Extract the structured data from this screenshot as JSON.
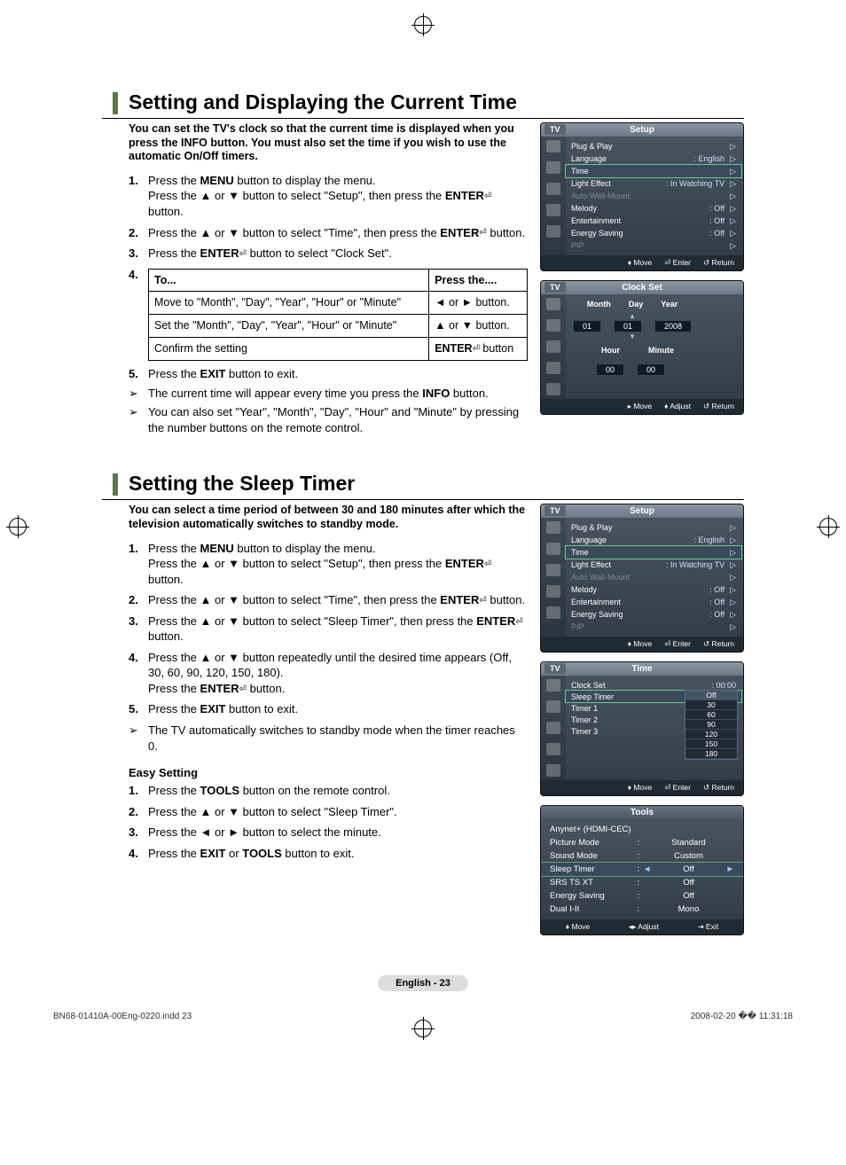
{
  "section1": {
    "title": "Setting and Displaying the Current Time",
    "intro": "You can set the TV's clock so that the current time is displayed when you press the INFO button. You must also set the time if you wish to use the automatic On/Off timers.",
    "step1a": "Press the ",
    "step1b": " button to display the menu.",
    "step1c": "Press the ▲ or ▼ button to select \"Setup\", then press the ",
    "step1d": " button.",
    "step2a": "Press the ▲ or ▼ button to select \"Time\", then press the ",
    "step2b": " button.",
    "step3a": "Press the ",
    "step3b": " button to select \"Clock Set\".",
    "table": {
      "h1": "To...",
      "h2": "Press the....",
      "r1c1": "Move to \"Month\", \"Day\", \"Year\", \"Hour\" or \"Minute\"",
      "r1c2": "◄ or ► button.",
      "r2c1": "Set the \"Month\", \"Day\", \"Year\", \"Hour\" or \"Minute\"",
      "r2c2": "▲ or ▼ button.",
      "r3c1": "Confirm the setting",
      "r3c2_a": "ENTER",
      "r3c2_b": " button"
    },
    "step5a": "Press the ",
    "step5b": " button to exit.",
    "note1a": "The current time will appear every time you press the ",
    "note1b": " button.",
    "note2": "You can also set \"Year\", \"Month\", \"Day\", \"Hour\" and \"Minute\" by pressing the number buttons on the remote control."
  },
  "section2": {
    "title": "Setting the Sleep Timer",
    "intro": "You can select a time period of between 30 and 180 minutes after which the television automatically switches to standby mode.",
    "step1a": "Press the ",
    "step1b": " button to display the menu.",
    "step1c": "Press the ▲ or ▼ button to select \"Setup\", then press the ",
    "step1d": " button.",
    "step2a": "Press the ▲ or ▼ button to select \"Time\", then press the ",
    "step2b": " button.",
    "step3a": "Press the ▲ or ▼ button to select \"Sleep Timer\", then press the ",
    "step3b": " button.",
    "step4a": "Press the ▲ or ▼ button repeatedly until the desired time appears (Off, 30, 60, 90, 120, 150, 180).",
    "step4b": "Press the ",
    "step4c": " button.",
    "step5a": "Press the ",
    "step5b": " button to exit.",
    "note1": "The TV automatically switches to standby mode when the timer reaches 0.",
    "easy_title": "Easy Setting",
    "easy1a": "Press the ",
    "easy1b": " button on the remote control.",
    "easy2": "Press the ▲ or ▼ button to select \"Sleep Timer\".",
    "easy3": "Press the ◄ or ► button to select the minute.",
    "easy4a": "Press the ",
    "easy4b": " or ",
    "easy4c": " button to exit."
  },
  "buttons": {
    "menu": "MENU",
    "enter": "ENTER",
    "exit": "EXIT",
    "info": "INFO",
    "tools": "TOOLS"
  },
  "osd_setup": {
    "tab": "TV",
    "title": "Setup",
    "rows": [
      {
        "lbl": "Plug & Play",
        "val": ""
      },
      {
        "lbl": "Language",
        "val": ": English"
      },
      {
        "lbl": "Time",
        "val": "",
        "hl": true
      },
      {
        "lbl": "Light Effect",
        "val": ": In Watching TV"
      },
      {
        "lbl": "Auto Wall-Mount",
        "val": "",
        "dim": true
      },
      {
        "lbl": "Melody",
        "val": ": Off"
      },
      {
        "lbl": "Entertainment",
        "val": ": Off"
      },
      {
        "lbl": "Energy Saving",
        "val": ": Off"
      },
      {
        "lbl": "PIP",
        "val": "",
        "dim": true
      }
    ],
    "foot": [
      "♦ Move",
      "⏎ Enter",
      "↺ Return"
    ]
  },
  "osd_clock": {
    "tab": "TV",
    "title": "Clock Set",
    "labels1": [
      "Month",
      "Day",
      "Year"
    ],
    "values1": [
      "01",
      "01",
      "2008"
    ],
    "labels2": [
      "Hour",
      "Minute"
    ],
    "values2": [
      "00",
      "00"
    ],
    "foot": [
      "▸ Move",
      "♦ Adjust",
      "↺ Return"
    ]
  },
  "osd_time": {
    "tab": "TV",
    "title": "Time",
    "rows": [
      {
        "lbl": "Clock Set",
        "val": ": 00:00"
      },
      {
        "lbl": "Sleep Timer",
        "val": ":",
        "hl": true
      },
      {
        "lbl": "Timer 1",
        "val": ":"
      },
      {
        "lbl": "Timer 2",
        "val": ":"
      },
      {
        "lbl": "Timer 3",
        "val": ":"
      }
    ],
    "dropdown": [
      "Off",
      "30",
      "60",
      "90",
      "120",
      "150",
      "180"
    ],
    "foot": [
      "♦ Move",
      "⏎ Enter",
      "↺ Return"
    ]
  },
  "osd_tools": {
    "title": "Tools",
    "rows": [
      {
        "lbl": "Anynet+ (HDMI-CEC)",
        "val": ""
      },
      {
        "lbl": "Picture Mode",
        "val": "Standard"
      },
      {
        "lbl": "Sound Mode",
        "val": "Custom"
      },
      {
        "lbl": "Sleep Timer",
        "val": "Off",
        "hl": true
      },
      {
        "lbl": "SRS TS XT",
        "val": "Off"
      },
      {
        "lbl": "Energy Saving",
        "val": "Off"
      },
      {
        "lbl": "Dual I-II",
        "val": "Mono"
      }
    ],
    "foot": [
      "♦ Move",
      "◂▸ Adjust",
      "⇥ Exit"
    ]
  },
  "page_num": "English - 23",
  "footer": {
    "left": "BN68-01410A-00Eng-0220.indd   23",
    "right": "2008-02-20   �� 11:31:18"
  }
}
